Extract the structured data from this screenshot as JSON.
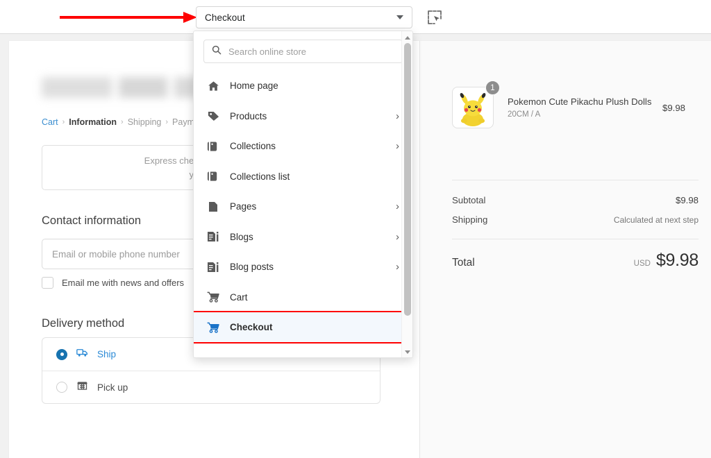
{
  "toolbar": {
    "page_selector_value": "Checkout",
    "page_selector_icon": "chevron-down-icon",
    "inspect_icon": "select-element-icon",
    "annotation_arrow": "red-arrow-pointing-right"
  },
  "dropdown": {
    "search_placeholder": "Search online store",
    "search_icon": "search-icon",
    "items": [
      {
        "label": "Home page",
        "icon": "home-icon",
        "has_submenu": false,
        "selected": false
      },
      {
        "label": "Products",
        "icon": "tag-icon",
        "has_submenu": true,
        "selected": false
      },
      {
        "label": "Collections",
        "icon": "collection-icon",
        "has_submenu": true,
        "selected": false
      },
      {
        "label": "Collections list",
        "icon": "collection-icon",
        "has_submenu": false,
        "selected": false
      },
      {
        "label": "Pages",
        "icon": "page-icon",
        "has_submenu": true,
        "selected": false
      },
      {
        "label": "Blogs",
        "icon": "blog-icon",
        "has_submenu": true,
        "selected": false
      },
      {
        "label": "Blog posts",
        "icon": "blog-icon",
        "has_submenu": true,
        "selected": false
      },
      {
        "label": "Cart",
        "icon": "cart-icon",
        "has_submenu": false,
        "selected": false
      },
      {
        "label": "Checkout",
        "icon": "cart-icon",
        "has_submenu": false,
        "selected": true
      }
    ],
    "scrollbar": {
      "up_arrow": "scroll-up-arrow",
      "down_arrow": "scroll-down-arrow"
    },
    "highlight_color": "#fe0000",
    "selected_row_bg": "#f3f8fd"
  },
  "checkout": {
    "store_title": "",
    "breadcrumb": [
      {
        "label": "Cart",
        "state": "link"
      },
      {
        "label": "Information",
        "state": "current"
      },
      {
        "label": "Shipping",
        "state": "muted"
      },
      {
        "label": "Payme",
        "state": "muted"
      }
    ],
    "breadcrumb_separator": "›",
    "express": {
      "legend": "Expre",
      "message_line1": "Express checkout isn't available ri",
      "message_line2": "your inform"
    },
    "contact": {
      "title": "Contact information",
      "email_placeholder": "Email or mobile phone number",
      "newsletter_label": "Email me with news and offers",
      "newsletter_checked": false
    },
    "delivery": {
      "title": "Delivery method",
      "options": [
        {
          "label": "Ship",
          "icon": "truck-icon",
          "selected": true
        },
        {
          "label": "Pick up",
          "icon": "store-icon",
          "selected": false
        }
      ]
    }
  },
  "summary": {
    "line_items": [
      {
        "name": "Pokemon Cute Pikachu Plush Dolls",
        "variant": "20CM / A",
        "price": "$9.98",
        "quantity": "1",
        "image": "pikachu-plush-thumbnail"
      }
    ],
    "rows": [
      {
        "key": "Subtotal",
        "value": "$9.98",
        "muted": false
      },
      {
        "key": "Shipping",
        "value": "Calculated at next step",
        "muted": true
      }
    ],
    "total": {
      "key": "Total",
      "currency": "USD",
      "value": "$9.98"
    }
  },
  "colors": {
    "accent_blue": "#1773b0",
    "link_blue": "#3b8ed0",
    "annotation_red": "#fe0000",
    "panel_gray": "#fafafa"
  }
}
